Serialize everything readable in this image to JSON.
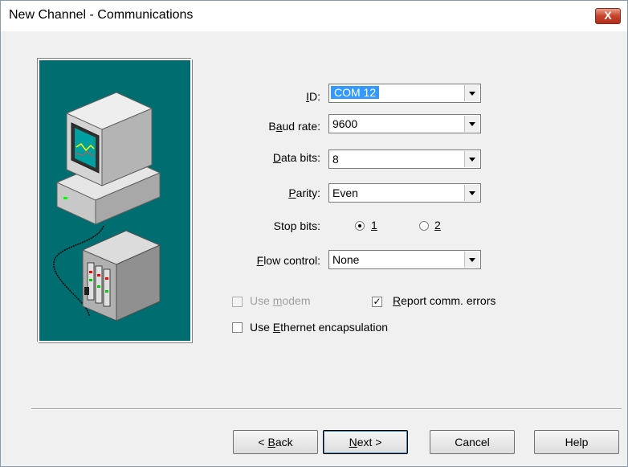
{
  "window": {
    "title": "New Channel - Communications",
    "close_label": "X"
  },
  "fields": {
    "id": {
      "label": "ID:",
      "value": "COM 12"
    },
    "baud_rate": {
      "label": "Baud rate:",
      "value": "9600"
    },
    "data_bits": {
      "label": "Data bits:",
      "value": "8"
    },
    "parity": {
      "label": "Parity:",
      "value": "Even"
    },
    "stop_bits": {
      "label": "Stop bits:",
      "options": [
        "1",
        "2"
      ],
      "selected": "1"
    },
    "flow_control": {
      "label": "Flow control:",
      "value": "None"
    }
  },
  "checkboxes": {
    "use_modem": {
      "label": "Use modem",
      "checked": false,
      "enabled": false
    },
    "report_comm_errors": {
      "label": "Report comm. errors",
      "checked": true,
      "enabled": true
    },
    "use_ethernet": {
      "label": "Use Ethernet encapsulation",
      "checked": false,
      "enabled": true
    }
  },
  "buttons": {
    "back": "< Back",
    "next": "Next >",
    "cancel": "Cancel",
    "help": "Help"
  },
  "colors": {
    "illustration_bg": "#006e70",
    "close_button": "#c7422a",
    "selection": "#3399ff"
  },
  "icons": [
    "computer-monitor-icon",
    "plc-rack-icon",
    "serial-cable-icon"
  ]
}
